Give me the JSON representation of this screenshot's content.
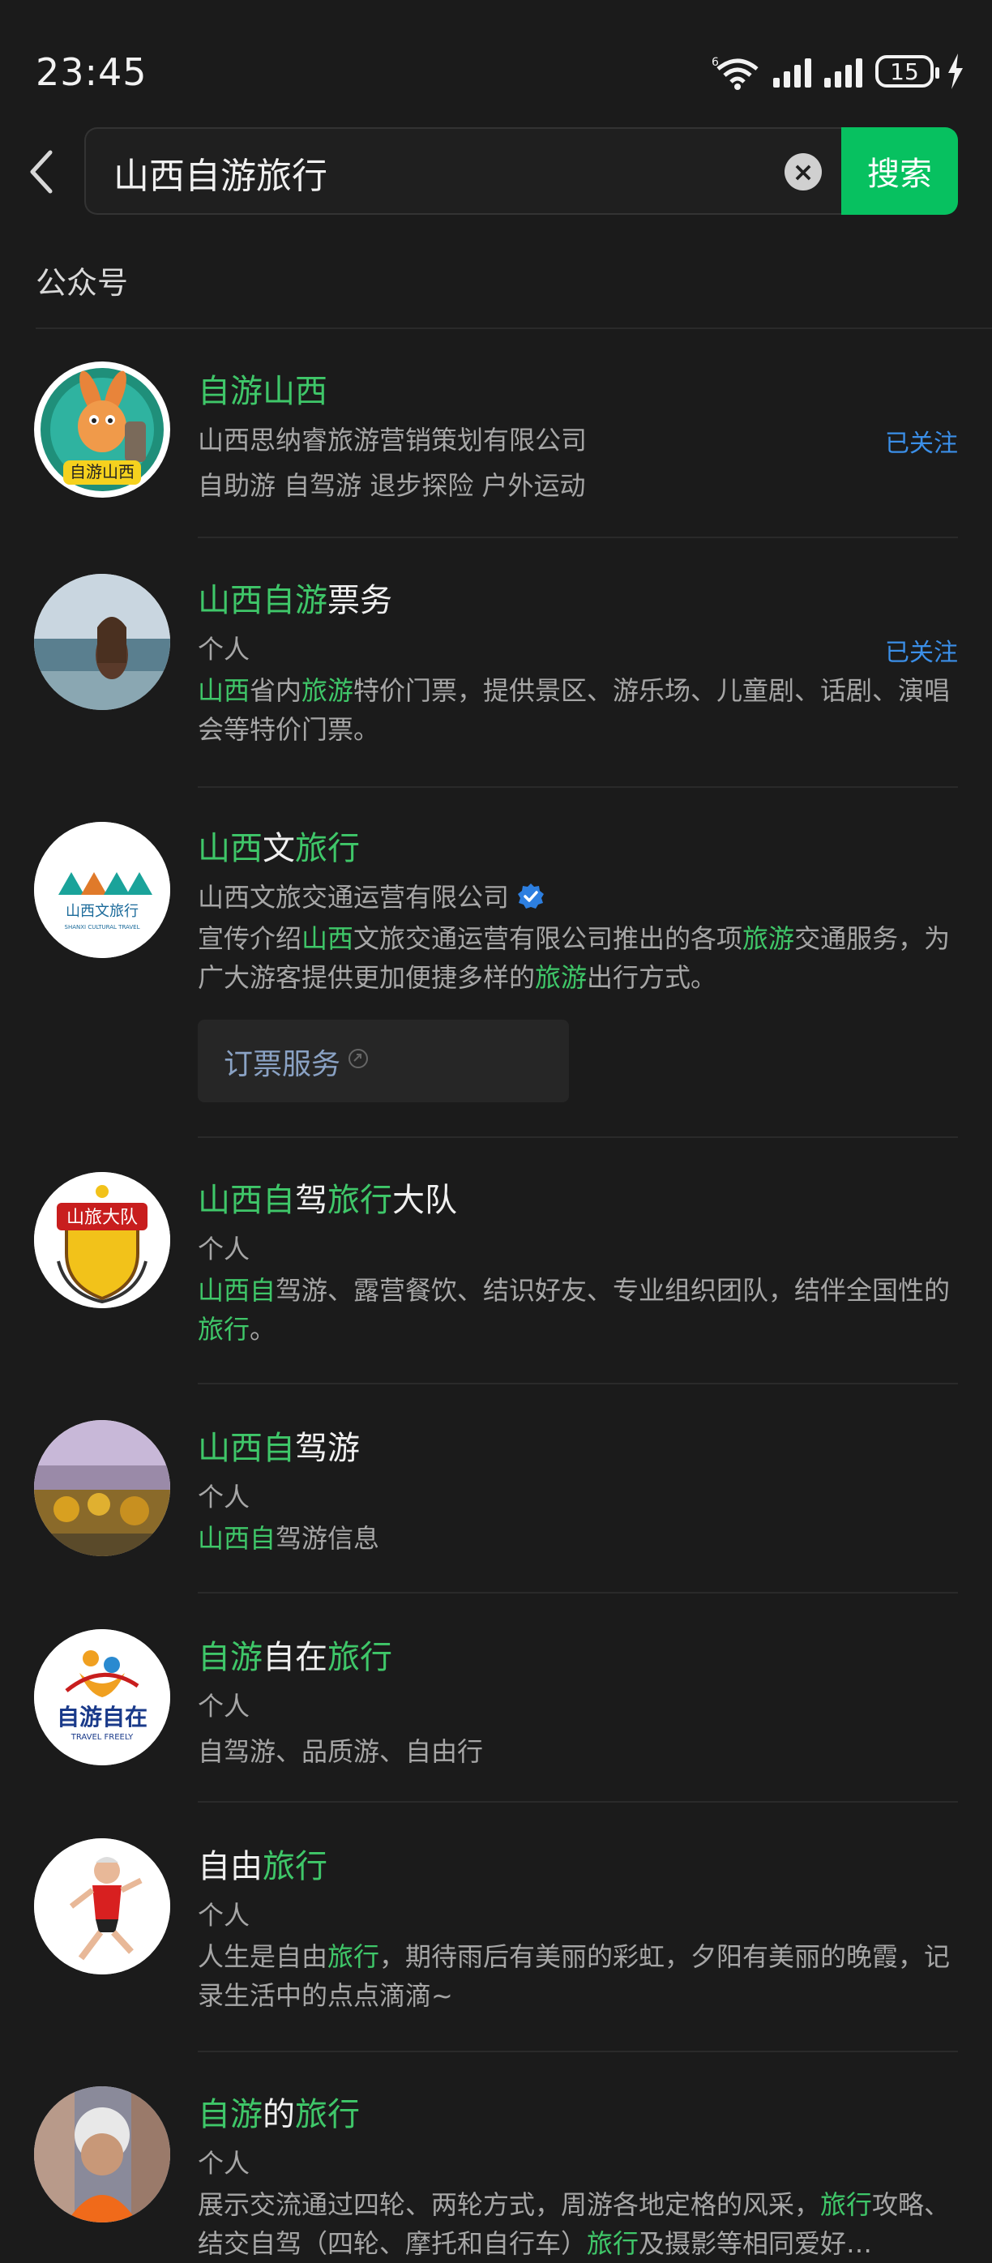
{
  "status": {
    "time": "23:45",
    "battery": "15"
  },
  "search": {
    "query": "山西自游旅行",
    "button": "搜索"
  },
  "section_title": "公众号",
  "accounts": [
    {
      "name": [
        "自游山西",
        ""
      ],
      "owner": "山西思纳睿旅游营销策划有限公司",
      "followed": "已关注",
      "desc": "自助游 自驾游 退步探险 户外运动",
      "avatar_text": "自游山西"
    },
    {
      "name": [
        "山西自游",
        "票务"
      ],
      "owner": "个人",
      "followed": "已关注",
      "desc_parts": [
        "山西",
        "省内",
        "旅游",
        "特价门票，提供景区、游乐场、儿童剧、话剧、演唱会等特价门票。"
      ]
    },
    {
      "name": [
        "山西",
        "文",
        "旅行"
      ],
      "owner": "山西文旅交通运营有限公司",
      "desc_parts": [
        "宣传介绍",
        "山西",
        "文旅交通运营有限公司推出的各项",
        "旅游",
        "交通服务，为广大游客提供更加便捷多样的",
        "旅游",
        "出行方式。"
      ],
      "service": "订票服务",
      "logo_text": "山西文旅行",
      "logo_sub": "SHANXI CULTURAL TRAVEL"
    },
    {
      "name": [
        "山西自",
        "驾",
        "旅行",
        "大队"
      ],
      "owner": "个人",
      "desc_parts": [
        "山西自",
        "驾游、露营餐饮、结识好友、专业组织团队，结伴全国性的",
        "旅行",
        "。"
      ],
      "avatar_text": "山旅大队"
    },
    {
      "name": [
        "山西自",
        "驾游"
      ],
      "owner": "个人",
      "desc_parts": [
        "山西自",
        "驾游信息"
      ]
    },
    {
      "name": [
        "自游",
        "自在",
        "旅行"
      ],
      "owner": "个人",
      "desc": "自驾游、品质游、自由行",
      "avatar_text": "自游自在",
      "avatar_sub": "TRAVEL FREELY"
    },
    {
      "name": [
        "自由",
        "旅行"
      ],
      "owner": "个人",
      "desc_parts": [
        "人生是自由",
        "旅行",
        "，期待雨后有美丽的彩虹，夕阳有美丽的晚霞，记录生活中的点点滴滴~"
      ]
    },
    {
      "name": [
        "自游",
        "的",
        "旅行"
      ],
      "owner": "个人",
      "desc_parts": [
        "展示交流通过四轮、两轮方式，周游各地定格的风采，",
        "旅行",
        "攻略、结交自驾（四轮、摩托和自行车）",
        "旅行",
        "及摄影等相同爱好…"
      ]
    }
  ],
  "colors": {
    "highlight": "#3fc769",
    "follow": "#3b8fe8",
    "search_button": "#07c160"
  }
}
